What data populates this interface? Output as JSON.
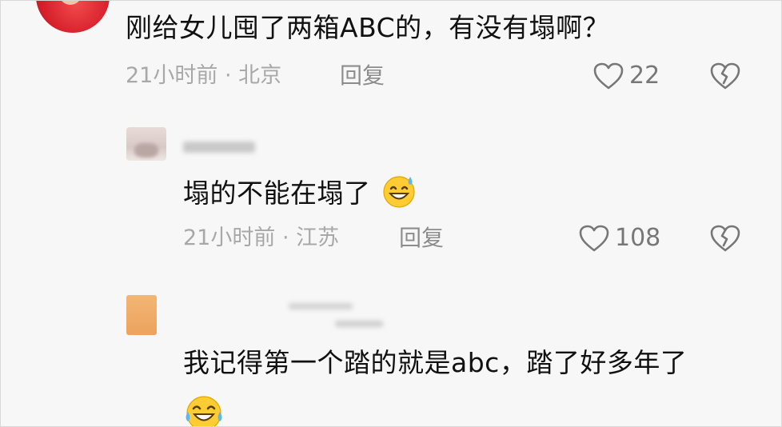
{
  "comments": [
    {
      "text": "刚给女儿囤了两箱ABC的，有没有塌啊？",
      "meta": "21小时前 · 北京",
      "reply_label": "回复",
      "likes": "22"
    },
    {
      "text": "塌的不能在塌了",
      "emoji": "sweat-smile-emoji",
      "meta": "21小时前 · 江苏",
      "reply_label": "回复",
      "likes": "108"
    },
    {
      "text": "我记得第一个踏的就是abc，踏了好多年了",
      "emoji": "tears-of-joy-emoji"
    }
  ],
  "icons": {
    "like": "heart-outline-icon",
    "dislike": "broken-heart-icon"
  },
  "colors": {
    "text": "#111111",
    "meta": "#a8a8a8",
    "icon": "#777777",
    "background": "#f7f7f7"
  }
}
